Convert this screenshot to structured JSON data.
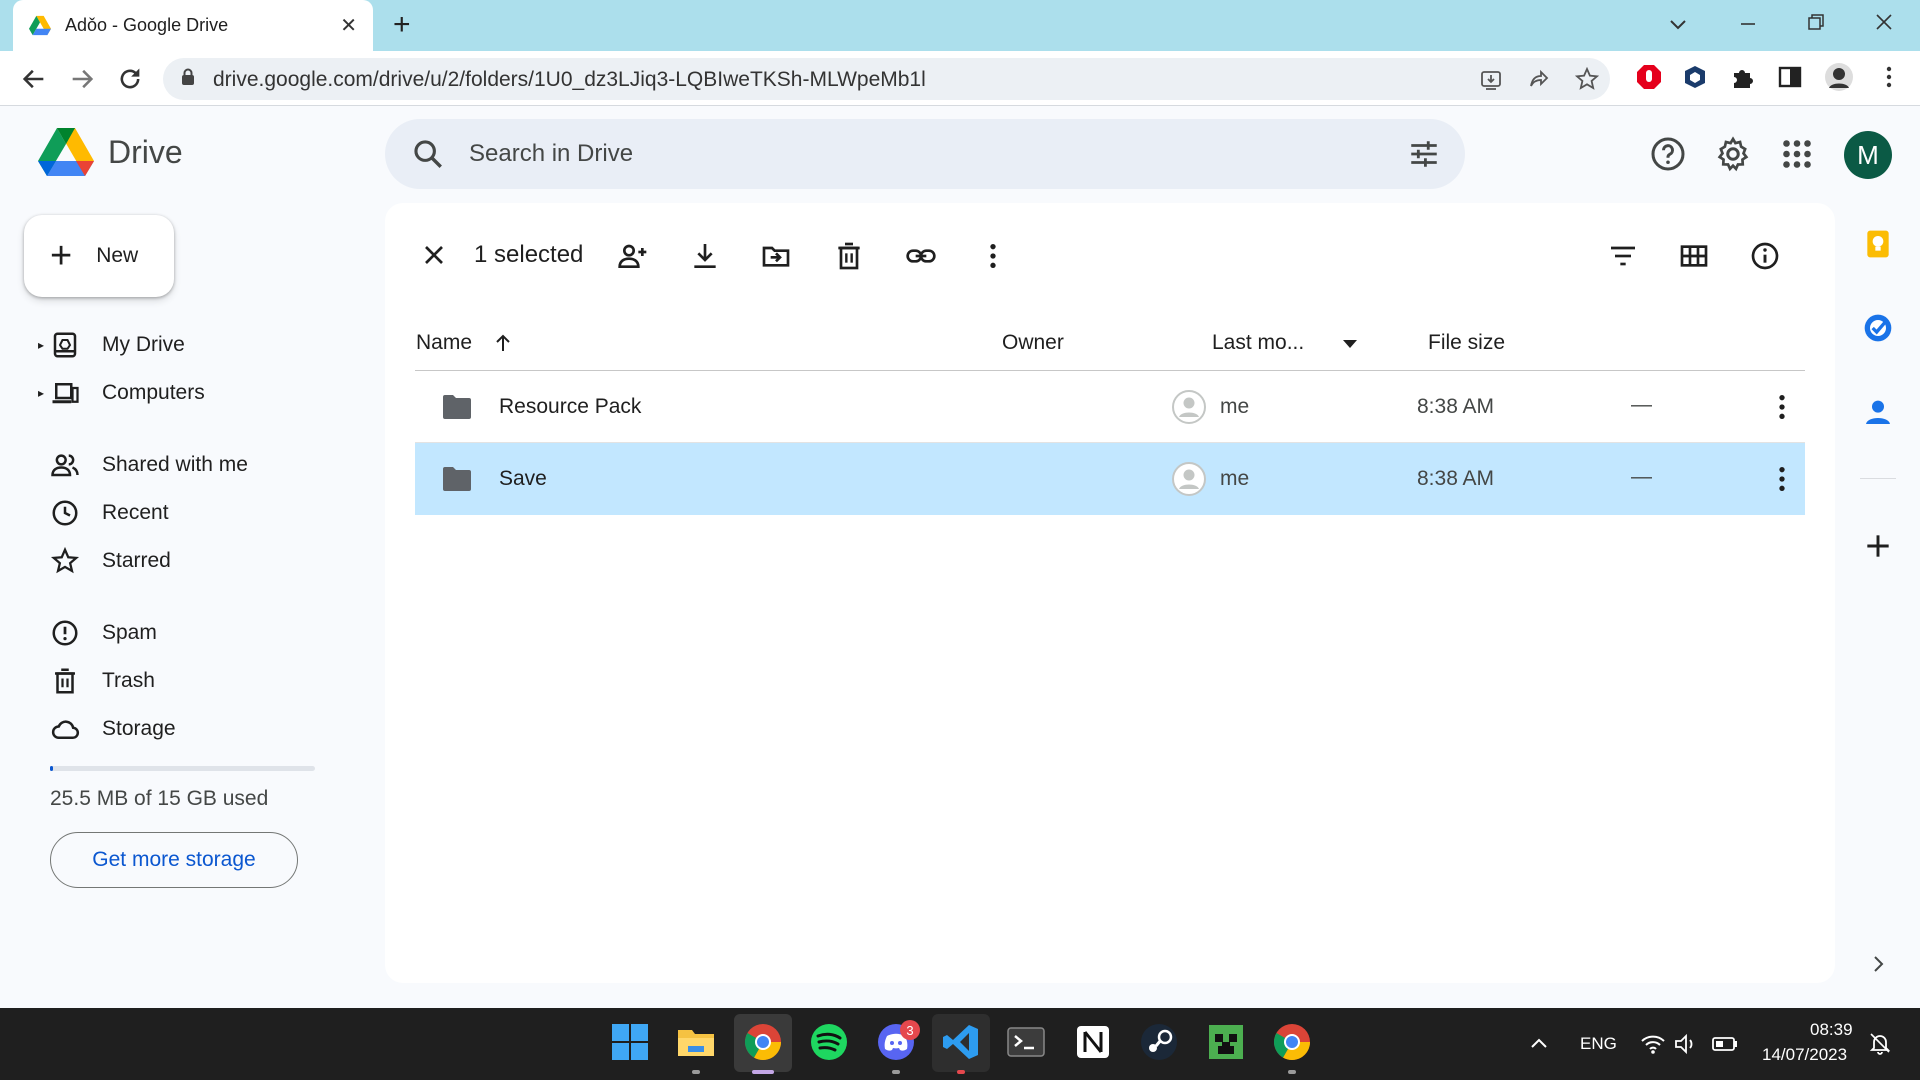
{
  "browser": {
    "tab_title": "Adǒo - Google Drive",
    "url": "drive.google.com/drive/u/2/folders/1U0_dz3LJiq3-LQBIweTKSh-MLWpeMb1l",
    "new_tab_label": "+",
    "close_tab_label": "✕"
  },
  "drive": {
    "brand": "Drive",
    "search_placeholder": "Search in Drive",
    "avatar_letter": "M"
  },
  "sidebar": {
    "new_label": "New",
    "items": [
      {
        "label": "My Drive",
        "icon": "my-drive-icon"
      },
      {
        "label": "Computers",
        "icon": "computers-icon"
      },
      {
        "label": "Shared with me",
        "icon": "shared-icon"
      },
      {
        "label": "Recent",
        "icon": "clock-icon"
      },
      {
        "label": "Starred",
        "icon": "star-icon"
      },
      {
        "label": "Spam",
        "icon": "spam-icon"
      },
      {
        "label": "Trash",
        "icon": "trash-icon"
      },
      {
        "label": "Storage",
        "icon": "cloud-icon"
      }
    ],
    "storage_used": "25.5 MB of 15 GB used",
    "storage_fraction": 0.0017,
    "get_more_label": "Get more storage"
  },
  "selection": {
    "count_label": "1 selected"
  },
  "table": {
    "headers": {
      "name": "Name",
      "owner": "Owner",
      "modified": "Last mo...",
      "size": "File size"
    },
    "rows": [
      {
        "name": "Resource Pack",
        "owner": "me",
        "modified": "8:38 AM",
        "size": "—",
        "selected": false
      },
      {
        "name": "Save",
        "owner": "me",
        "modified": "8:38 AM",
        "size": "—",
        "selected": true
      }
    ]
  },
  "taskbar": {
    "discord_badge": "3",
    "language": "ENG",
    "time": "08:39",
    "date": "14/07/2023"
  },
  "colors": {
    "accent": "#0b57d0",
    "selected_row": "#c2e7ff",
    "avatar": "#0b5a45"
  }
}
